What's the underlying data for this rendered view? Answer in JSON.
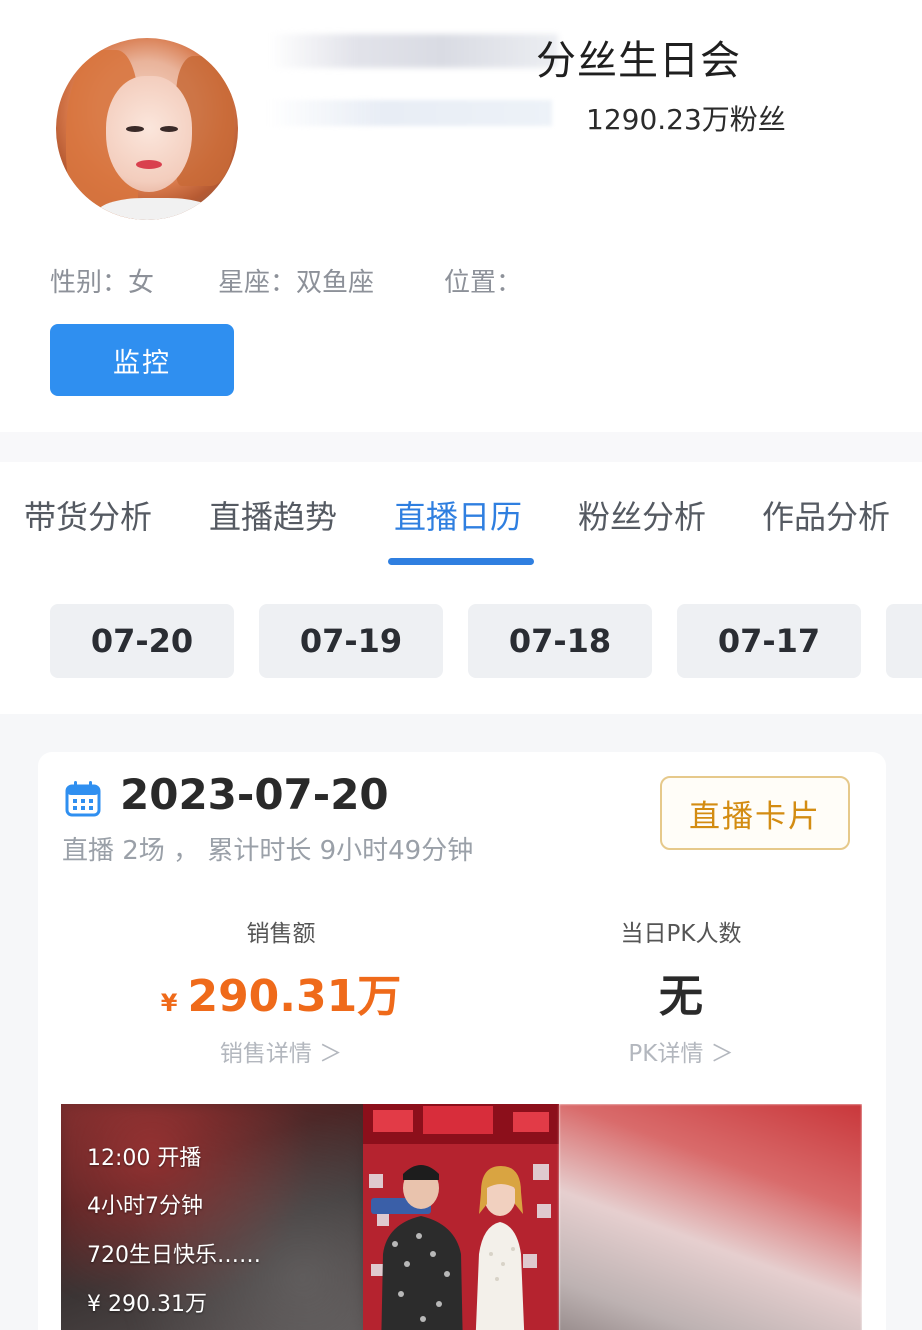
{
  "profile": {
    "title_visible": "分丝生日会",
    "fans": "1290.23万粉丝",
    "gender": "性别：女",
    "zodiac": "星座：双鱼座",
    "location": "位置：",
    "monitor_label": "监控"
  },
  "tabs": [
    {
      "label": "带货分析"
    },
    {
      "label": "直播趋势"
    },
    {
      "label": "直播日历",
      "active": true
    },
    {
      "label": "粉丝分析"
    },
    {
      "label": "作品分析"
    }
  ],
  "dates": [
    "07-20",
    "07-19",
    "07-18",
    "07-17"
  ],
  "day_card": {
    "date": "2023-07-20",
    "summary": "直播 2场 ， 累计时长 9小时49分钟",
    "live_card_label": "直播卡片",
    "sales_label": "销售额",
    "sales_currency": "¥",
    "sales_value": "290.31万",
    "sales_detail": "销售详情 ＞",
    "pk_label": "当日PK人数",
    "pk_value": "无",
    "pk_detail": "PK详情 ＞"
  },
  "session": {
    "start": "12:00 开播",
    "duration": "4小时7分钟",
    "name": "720生日快乐……",
    "sales": "¥ 290.31万"
  },
  "colors": {
    "primary": "#2f8ff0",
    "tab_active": "#2f7fe0",
    "sales": "#ef6a1a",
    "live_card_border": "#e6c98b",
    "live_card_text": "#d38c12"
  },
  "icons": {
    "calendar": "calendar-icon"
  }
}
